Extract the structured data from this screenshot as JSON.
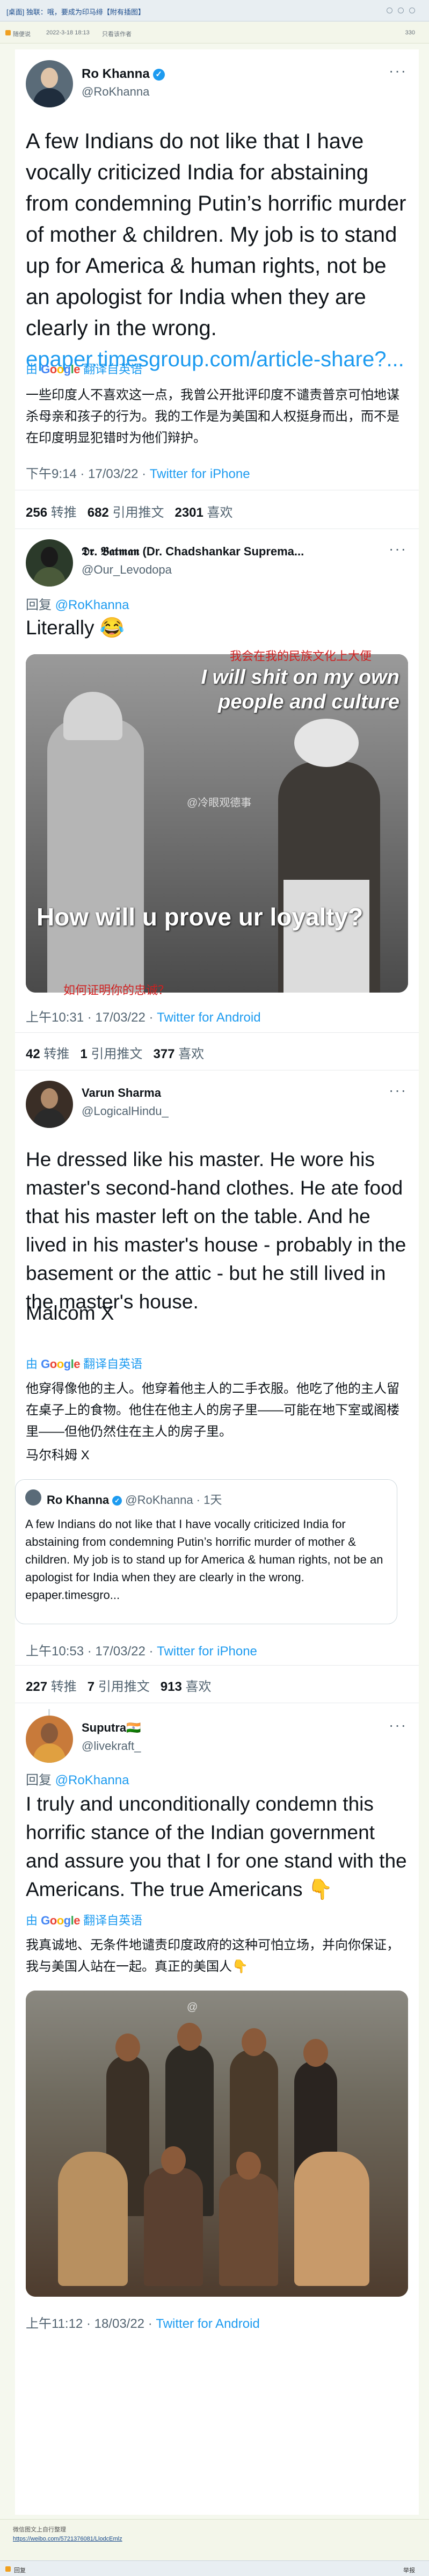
{
  "window": {
    "title": "[桌面] 独联：哦，要成为印马绯【附有插图】",
    "meta_author": "随便说",
    "meta_time": "2022-3-18 18:13",
    "meta_only": "只看该作者",
    "meta_count": "330"
  },
  "tweet1": {
    "name": "Ro Khanna",
    "handle": "@RoKhanna",
    "text": "A few Indians do not like that I have vocally criticized India for abstaining from condemning Putin’s horrific murder of mother & children. My job is to stand up for America & human rights, not be an apologist for India when they are clearly in the wrong.",
    "link": "epaper.timesgroup.com/article-share?...",
    "translate_label": "翻译自英语",
    "translation": "一些印度人不喜欢这一点，我曾公开批评印度不谴责普京可怕地谋杀母亲和孩子的行为。我的工作是为美国和人权挺身而出，而不是在印度明显犯错时为他们辩护。",
    "time": "下午9:14 · 17/03/22 ·",
    "app": "Twitter for iPhone",
    "retweets": "256",
    "retweets_label": "转推",
    "quotes": "682",
    "quotes_label": "引用推文",
    "likes": "2301",
    "likes_label": "喜欢"
  },
  "tweet2": {
    "name": "𝕯𝖗. 𝕭𝖆𝖙𝖒𝖆𝖓 (Dr. Chadshankar Suprema...",
    "handle": "@Our_Levodopa",
    "reply_prefix": "回复",
    "reply_to": "@RoKhanna",
    "text": "Literally 😂",
    "image_top": "I will shit on my own people and culture",
    "image_bottom": "How will u prove ur loyalty?",
    "overlay_top_cn": "我会在我的民族文化上大便",
    "overlay_bottom_cn": "如何证明你的忠诚？",
    "watermark": "@冷眼观德事",
    "time": "上午10:31 · 17/03/22 ·",
    "app": "Twitter for Android",
    "retweets": "42",
    "retweets_label": "转推",
    "quotes": "1",
    "quotes_label": "引用推文",
    "likes": "377",
    "likes_label": "喜欢"
  },
  "tweet3": {
    "name": "Varun Sharma",
    "handle": "@LogicalHindu_",
    "text": "He dressed like his master. He wore his master's second-hand clothes. He ate food that his master left on the table. And he lived in his master's house - probably in the basement or the attic - but he still lived in the master's house.",
    "sign": "Malcom X",
    "translate_label": "翻译自英语",
    "translation": "他穿得像他的主人。他穿着他主人的二手衣服。他吃了他的主人留在桌子上的食物。他住在他主人的房子里——可能在地下室或阁楼里——但他仍然住在主人的房子里。",
    "translation_sign": "马尔科姆 X",
    "quote_name": "Ro Khanna",
    "quote_handle": "@RoKhanna · 1天",
    "quote_text": "A few Indians do not like that I have vocally criticized India for abstaining from condemning Putin’s horrific murder of mother & children. My job is to stand up for America & human rights, not be an apologist for India when they are clearly in the wrong. epaper.timesgro...",
    "time": "上午10:53 · 17/03/22 ·",
    "app": "Twitter for iPhone",
    "retweets": "227",
    "retweets_label": "转推",
    "quotes": "7",
    "quotes_label": "引用推文",
    "likes": "913",
    "likes_label": "喜欢"
  },
  "tweet4": {
    "name": "Suputra🇮🇳",
    "handle": "@livekraft_",
    "reply_prefix": "回复",
    "reply_to": "@RoKhanna",
    "text": "I truly and unconditionally condemn this horrific stance of the Indian government and assure you that I for one stand with the Americans. The true Americans 👇",
    "translate_label": "翻译自英语",
    "translation": "我真诚地、无条件地谴责印度政府的这种可怕立场，并向你保证，我与美国人站在一起。真正的美国人👇",
    "time": "上午11:12 · 18/03/22 ·",
    "app": "Twitter for Android"
  },
  "footer": {
    "source_label": "微信图文上自行整理",
    "source_url": "https://weibo.com/5721376081/LlodcEmlz",
    "bar_left": "回复",
    "bar_right": "举报"
  },
  "colors": {
    "link": "#1d9bf0",
    "muted": "#536471",
    "accent_red": "#d02020"
  },
  "icons": {
    "verified": "verified-badge-icon",
    "google": "google-logo-icon",
    "more": "more-options-icon"
  }
}
